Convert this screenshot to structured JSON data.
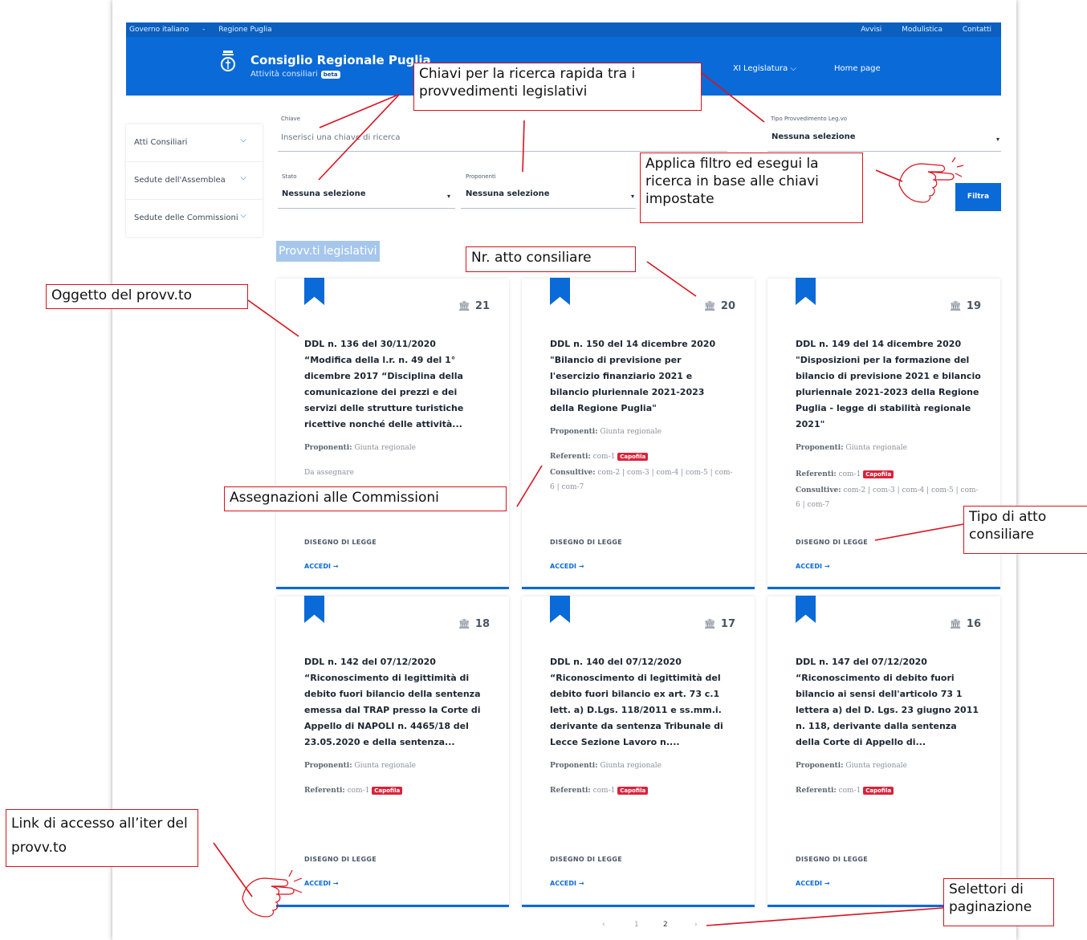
{
  "topbar": {
    "links_left": [
      "Governo italiano",
      "-",
      "Regione Puglia"
    ],
    "links_right": [
      "Avvisi",
      "Modulistica",
      "Contatti"
    ]
  },
  "header": {
    "title": "Consiglio Regionale Puglia",
    "subtitle": "Attività consiliari",
    "beta": "beta",
    "legislatura": "XI Legislatura",
    "homepage": "Home page"
  },
  "sidebar": {
    "items": [
      {
        "label": "Atti Consiliari"
      },
      {
        "label": "Sedute dell'Assemblea"
      },
      {
        "label": "Sedute delle Commissioni"
      }
    ]
  },
  "filters": {
    "chiave_label": "Chiave",
    "chiave_placeholder": "Inserisci una chiave di ricerca",
    "tipo_label": "Tipo Provvedimento Leg.vo",
    "tipo_value": "Nessuna selezione",
    "stato_label": "Stato",
    "stato_value": "Nessuna selezione",
    "proponenti_label": "Proponenti",
    "proponenti_value": "Nessuna selezione",
    "filter_button": "Filtra"
  },
  "section_title": "Provv.ti legislativi",
  "cards": [
    {
      "number": "21",
      "title": "DDL n. 136 del 30/11/2020 “Modifica della l.r. n. 49 del 1° dicembre 2017 “Disciplina della comunicazione dei prezzi e dei servizi delle strutture turistiche ricettive nonché delle attività...",
      "proponenti_label": "Proponenti:",
      "proponenti": "Giunta regionale",
      "assegnazione": "Da assegnare",
      "tipo": "DISEGNO DI LEGGE",
      "accedi": "ACCEDI"
    },
    {
      "number": "20",
      "title": "DDL n. 150 del 14 dicembre 2020 \"Bilancio di previsione per l'esercizio finanziario 2021 e bilancio pluriennale 2021-2023 della Regione Puglia\"",
      "proponenti_label": "Proponenti:",
      "proponenti": "Giunta regionale",
      "referenti_label": "Referenti:",
      "referenti": "com-1",
      "capofila": "Capofila",
      "consultive_label": "Consultive:",
      "consultive": "com-2 | com-3 | com-4 | com-5 | com-6 | com-7",
      "tipo": "DISEGNO DI LEGGE",
      "accedi": "ACCEDI"
    },
    {
      "number": "19",
      "title": "DDL n. 149 del 14 dicembre 2020 \"Disposizioni per la formazione del bilancio di previsione 2021 e bilancio pluriennale 2021-2023 della Regione Puglia - legge di stabilità regionale 2021\"",
      "proponenti_label": "Proponenti:",
      "proponenti": "Giunta regionale",
      "referenti_label": "Referenti:",
      "referenti": "com-1",
      "capofila": "Capofila",
      "consultive_label": "Consultive:",
      "consultive": "com-2 | com-3 | com-4 | com-5 | com-6 | com-7",
      "tipo": "DISEGNO DI LEGGE",
      "accedi": "ACCEDI"
    },
    {
      "number": "18",
      "title": "DDL n. 142 del 07/12/2020 “Riconoscimento di legittimità di debito fuori bilancio della sentenza emessa dal TRAP presso la Corte di Appello di NAPOLI n. 4465/18 del 23.05.2020 e della sentenza...",
      "proponenti_label": "Proponenti:",
      "proponenti": "Giunta regionale",
      "referenti_label": "Referenti:",
      "referenti": "com-1",
      "capofila": "Capofila",
      "tipo": "DISEGNO DI LEGGE",
      "accedi": "ACCEDI"
    },
    {
      "number": "17",
      "title": "DDL n. 140 del 07/12/2020 “Riconoscimento di legittimità del debito fuori bilancio ex art. 73 c.1 lett. a) D.Lgs. 118/2011 e ss.mm.i. derivante da sentenza Tribunale di Lecce Sezione Lavoro n....",
      "proponenti_label": "Proponenti:",
      "proponenti": "Giunta regionale",
      "referenti_label": "Referenti:",
      "referenti": "com-1",
      "capofila": "Capofila",
      "tipo": "DISEGNO DI LEGGE",
      "accedi": "ACCEDI"
    },
    {
      "number": "16",
      "title": "DDL n. 147 del 07/12/2020 “Riconoscimento di debito fuori bilancio ai sensi dell'articolo 73 1 lettera a) del D. Lgs. 23 giugno 2011 n. 118, derivante dalla sentenza della Corte di Appello di...",
      "proponenti_label": "Proponenti:",
      "proponenti": "Giunta regionale",
      "referenti_label": "Referenti:",
      "referenti": "com-1",
      "capofila": "Capofila",
      "tipo": "DISEGNO DI LEGGE",
      "accedi": "ACCEDI"
    }
  ],
  "pagination": {
    "prev": "‹",
    "pages": [
      "1",
      "2"
    ],
    "next": "›"
  },
  "annotations": {
    "chiavi": "Chiavi per la ricerca rapida tra i provvedimenti legislativi",
    "applica": "Applica filtro ed esegui la ricerca in base alle chiavi impostate",
    "nr_atto": "Nr. atto consiliare",
    "oggetto": "Oggetto del provv.to",
    "assegnazioni": "Assegnazioni alle Commissioni",
    "tipo_atto": "Tipo di atto consiliare",
    "link_accesso": "Link di accesso all’iter del provv.to",
    "selettori": "Selettori di paginazione"
  },
  "colors": {
    "primary": "#0a6ad8",
    "annotation": "#d9121f",
    "capofila": "#d9233b"
  }
}
